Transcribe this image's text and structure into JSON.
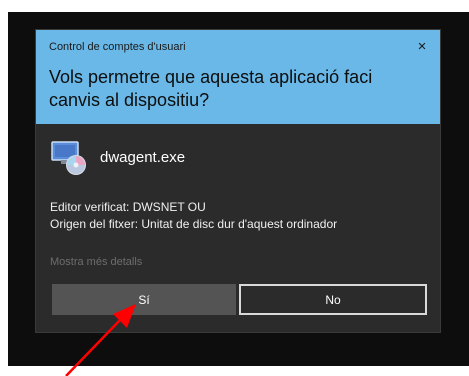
{
  "dialog": {
    "title": "Control de comptes d'usuari",
    "close_icon": "×",
    "question": "Vols permetre que aquesta aplicació faci canvis al dispositiu?",
    "app_name": "dwagent.exe",
    "publisher": "Editor verificat: DWSNET OU",
    "origin": "Origen del fitxer: Unitat de disc dur d'aquest ordinador",
    "more_details": "Mostra més detalls",
    "yes_label": "Sí",
    "no_label": "No"
  },
  "colors": {
    "header": "#69b8e7",
    "body": "#2b2b2b",
    "arrow": "#ff0000"
  },
  "icons": [
    "close-icon",
    "app-icon",
    "annotation-arrow"
  ]
}
